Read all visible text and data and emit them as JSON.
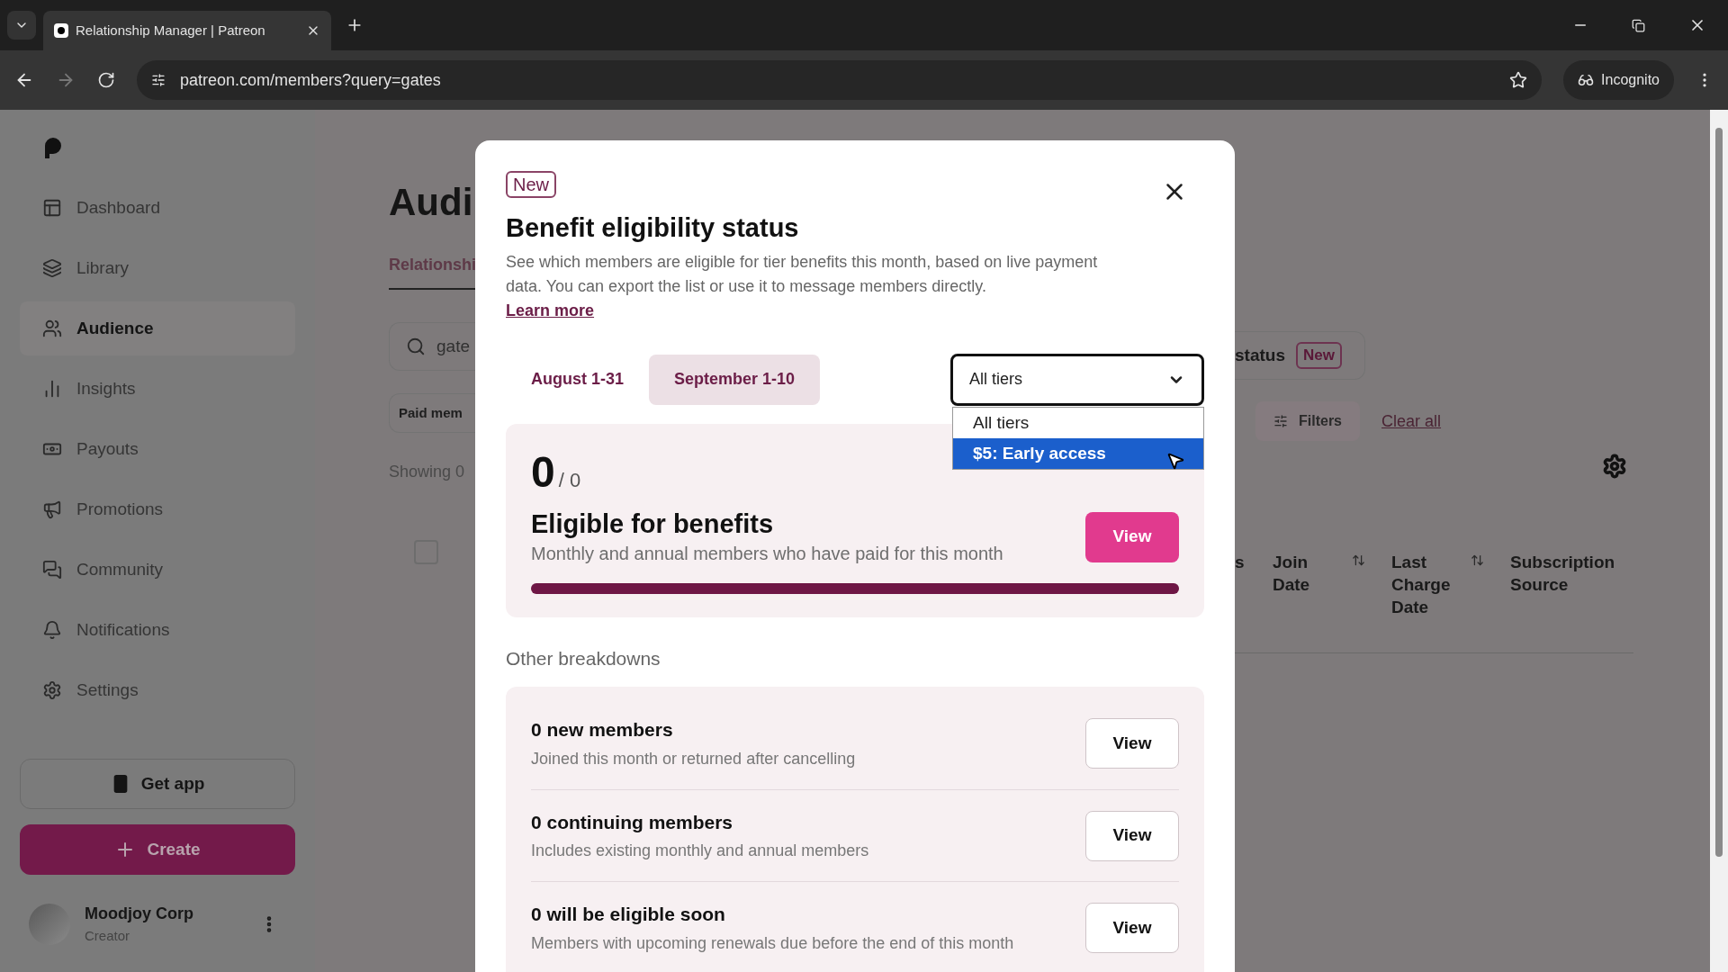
{
  "browser": {
    "tabs": [
      {
        "title": "Relationship Manager | Patreon",
        "selected": true
      }
    ],
    "url": "patreon.com/members?query=gates",
    "incognito_label": "Incognito"
  },
  "sidebar": {
    "items": [
      {
        "label": "Dashboard",
        "selected": false
      },
      {
        "label": "Library",
        "selected": false
      },
      {
        "label": "Audience",
        "selected": true
      },
      {
        "label": "Insights",
        "selected": false
      },
      {
        "label": "Payouts",
        "selected": false
      },
      {
        "label": "Promotions",
        "selected": false
      },
      {
        "label": "Community",
        "selected": false
      },
      {
        "label": "Notifications",
        "selected": false
      },
      {
        "label": "Settings",
        "selected": false
      }
    ],
    "get_app": "Get app",
    "create": "Create",
    "profile": {
      "name": "Moodjoy Corp",
      "role": "Creator"
    }
  },
  "background": {
    "select_all_checked": false,
    "heading": "Audi",
    "tab": "Relationshi",
    "search_value": "gate",
    "chip": "Paid mem",
    "showing": "Showing 0",
    "status_label": "status",
    "status_badge": "New",
    "filters": "Filters",
    "clear_all": "Clear all",
    "columns": [
      {
        "label": "s",
        "sortable": false
      },
      {
        "label": "Join Date",
        "sortable": true
      },
      {
        "label": "Last Charge Date",
        "sortable": true
      },
      {
        "label": "Subscription Source",
        "sortable": false
      }
    ]
  },
  "modal": {
    "badge": "New",
    "title": "Benefit eligibility status",
    "description": "See which members are eligible for tier benefits this month, based on live payment data. You can export the list or use it to message members directly.",
    "learn_more": "Learn more",
    "periods": [
      {
        "label": "August 1-31",
        "selected": false
      },
      {
        "label": "September 1-10",
        "selected": true
      }
    ],
    "tier_select": {
      "value": "All tiers",
      "expanded": true,
      "options": [
        {
          "label": "All tiers",
          "highlighted": false
        },
        {
          "label": "$5: Early access",
          "highlighted": true
        }
      ]
    },
    "eligible": {
      "count": "0",
      "total": "/ 0",
      "title": "Eligible for benefits",
      "subtitle": "Monthly and annual members who have paid for this month",
      "button": "View",
      "level": 1
    },
    "breakdowns_heading": "Other breakdowns",
    "breakdowns": [
      {
        "title": "0 new members",
        "subtitle": "Joined this month or returned after cancelling",
        "button": "View"
      },
      {
        "title": "0 continuing members",
        "subtitle": "Includes existing monthly and annual members",
        "button": "View"
      },
      {
        "title": "0 will be eligible soon",
        "subtitle": "Members with upcoming renewals due before the end of this month",
        "button": "View"
      }
    ]
  }
}
